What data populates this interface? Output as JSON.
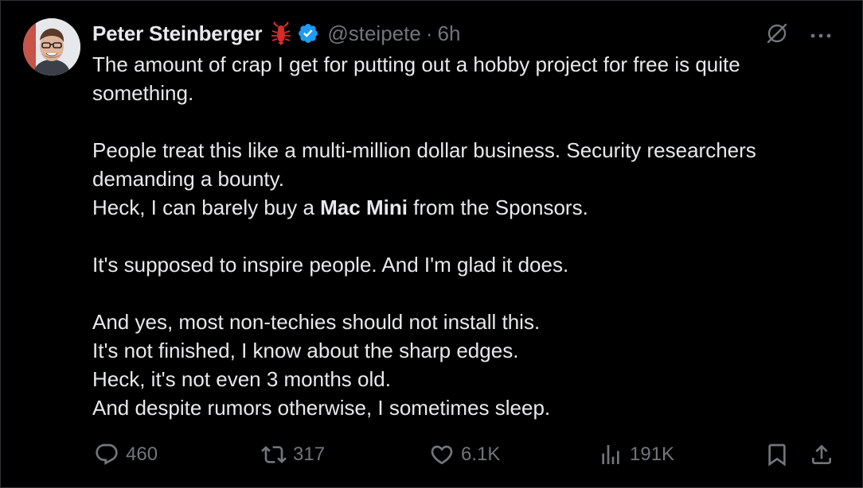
{
  "author": {
    "name": "Peter Steinberger",
    "handle": "@steipete",
    "separator": "·",
    "time": "6h"
  },
  "icons": {
    "avatar": "profile-photo",
    "emoji": "lobster-icon",
    "verified": "verified-badge-icon",
    "grok": "grok-icon",
    "more": "more-icon"
  },
  "colors": {
    "background": "#000000",
    "text": "#e7e9ea",
    "muted": "#71767b",
    "verified": "#1d9bf0",
    "lobster": "#d72b2b"
  },
  "tweet": {
    "line1": "The amount of crap I get for putting out a hobby project for free is quite something.",
    "line2": "People treat this like a multi-million dollar business. Security researchers demanding a bounty.",
    "line3_prefix": "Heck, I can barely buy a ",
    "line3_bold": "Mac Mini",
    "line3_suffix": " from the Sponsors.",
    "line4": "It's supposed to inspire people. And I'm glad it does.",
    "line5": "And yes, most non-techies should not install this.",
    "line6": "It's not finished, I know about the sharp edges.",
    "line7": "Heck, it's not even 3 months old.",
    "line8": "And despite rumors otherwise, I sometimes sleep."
  },
  "stats": {
    "replies": "460",
    "reposts": "317",
    "likes": "6.1K",
    "views": "191K"
  }
}
